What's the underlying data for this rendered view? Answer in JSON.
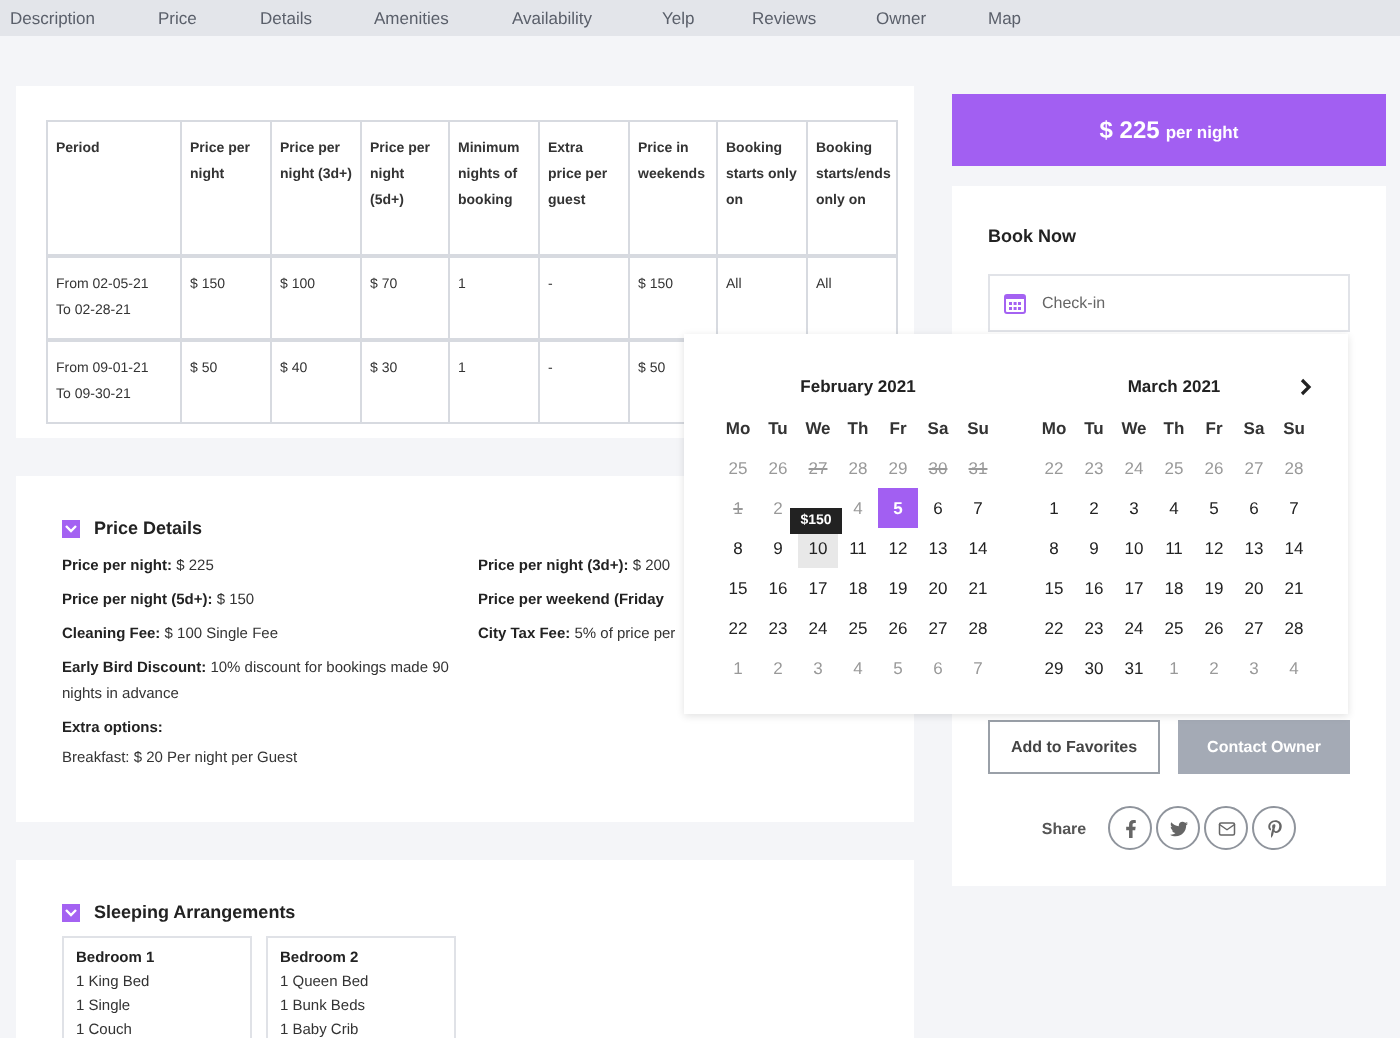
{
  "nav": [
    {
      "label": "Description"
    },
    {
      "label": "Price"
    },
    {
      "label": "Details"
    },
    {
      "label": "Amenities"
    },
    {
      "label": "Availability"
    },
    {
      "label": "Yelp"
    },
    {
      "label": "Reviews"
    },
    {
      "label": "Owner"
    },
    {
      "label": "Map"
    }
  ],
  "price_table": {
    "columns": [
      "Period",
      "Price per night",
      "Price per night (3d+)",
      "Price per night (5d+)",
      "Minimum nights of booking",
      "Extra price per guest",
      "Price in weekends",
      "Booking starts only on",
      "Booking starts/ends only on"
    ],
    "rows": [
      {
        "cells": [
          "From 02-05-21\nTo 02-28-21",
          "$ 150",
          "$ 100",
          "$ 70",
          "1",
          "-",
          "$ 150",
          "All",
          "All"
        ]
      },
      {
        "cells": [
          "From 09-01-21\nTo 09-30-21",
          "$ 50",
          "$ 40",
          "$ 30",
          "1",
          "-",
          "$ 50"
        ]
      }
    ]
  },
  "price_details": {
    "title": "Price Details",
    "expanded": true,
    "items": [
      {
        "label": "Price per night:",
        "value": "$ 225"
      },
      {
        "label": "Price per night (3d+):",
        "value": "$ 200"
      },
      {
        "label": "Price per night (5d+):",
        "value": "$ 150"
      },
      {
        "label": "Price per weekend (Friday"
      },
      {
        "label": "Cleaning Fee:",
        "value": "$ 100 Single Fee"
      },
      {
        "label": "City Tax Fee:",
        "value": "5% of price per"
      },
      {
        "label": "Early Bird Discount:",
        "value": "10% discount for bookings made 90 nights in advance"
      }
    ],
    "extra_title": "Extra options:",
    "extra_items": [
      "Breakfast: $ 20 Per night per Guest"
    ]
  },
  "sleeping": {
    "title": "Sleeping Arrangements",
    "expanded": true,
    "bedrooms": [
      {
        "name": "Bedroom 1",
        "beds": [
          "1 King Bed",
          "1 Single",
          "1 Couch"
        ]
      },
      {
        "name": "Bedroom 2",
        "beds": [
          "1 Queen Bed",
          "1 Bunk Beds",
          "1 Baby Crib"
        ]
      }
    ]
  },
  "price_bar": {
    "amount": "$ 225",
    "unit": "per night"
  },
  "booking": {
    "title": "Book Now",
    "checkin": {
      "placeholder": "Check-in"
    },
    "favorites": "Add to Favorites",
    "contact": "Contact Owner",
    "share_label": "Share"
  },
  "calendar": {
    "months": [
      {
        "title": "February 2021",
        "weekdays": [
          "Mo",
          "Tu",
          "We",
          "Th",
          "Fr",
          "Sa",
          "Su"
        ],
        "weeks": [
          [
            {
              "label": "25",
              "kind": "past",
              "selected": false
            },
            {
              "label": "26",
              "kind": "past",
              "selected": false
            },
            {
              "label": "27",
              "kind": "booked",
              "selected": false
            },
            {
              "label": "28",
              "kind": "past",
              "selected": false
            },
            {
              "label": "29",
              "kind": "past",
              "selected": false
            },
            {
              "label": "30",
              "kind": "booked",
              "selected": false
            },
            {
              "label": "31",
              "kind": "booked",
              "selected": false
            }
          ],
          [
            {
              "label": "1",
              "kind": "booked",
              "selected": false
            },
            {
              "label": "2",
              "kind": "past",
              "selected": false
            },
            {
              "kind": "past",
              "selected": false
            },
            {
              "label": "4",
              "kind": "past",
              "selected": false
            },
            {
              "label": "5",
              "kind": "day",
              "selected": true
            },
            {
              "label": "6",
              "kind": "day",
              "selected": false
            },
            {
              "label": "7",
              "kind": "day",
              "selected": false
            }
          ],
          [
            {
              "label": "8",
              "kind": "day",
              "selected": false
            },
            {
              "label": "9",
              "kind": "day",
              "selected": false
            },
            {
              "label": "10",
              "kind": "hover",
              "selected": false,
              "tooltip": "$150"
            },
            {
              "label": "11",
              "kind": "day",
              "selected": false
            },
            {
              "label": "12",
              "kind": "day",
              "selected": false
            },
            {
              "label": "13",
              "kind": "day",
              "selected": false
            },
            {
              "label": "14",
              "kind": "day",
              "selected": false
            }
          ],
          [
            {
              "label": "15",
              "kind": "day",
              "selected": false
            },
            {
              "label": "16",
              "kind": "day",
              "selected": false
            },
            {
              "label": "17",
              "kind": "day",
              "selected": false
            },
            {
              "label": "18",
              "kind": "day",
              "selected": false
            },
            {
              "label": "19",
              "kind": "day",
              "selected": false
            },
            {
              "label": "20",
              "kind": "day",
              "selected": false
            },
            {
              "label": "21",
              "kind": "day",
              "selected": false
            }
          ],
          [
            {
              "label": "22",
              "kind": "day",
              "selected": false
            },
            {
              "label": "23",
              "kind": "day",
              "selected": false
            },
            {
              "label": "24",
              "kind": "day",
              "selected": false
            },
            {
              "label": "25",
              "kind": "day",
              "selected": false
            },
            {
              "label": "26",
              "kind": "day",
              "selected": false
            },
            {
              "label": "27",
              "kind": "day",
              "selected": false
            },
            {
              "label": "28",
              "kind": "day",
              "selected": false
            }
          ],
          [
            {
              "label": "1",
              "kind": "other",
              "selected": false
            },
            {
              "label": "2",
              "kind": "other",
              "selected": false
            },
            {
              "label": "3",
              "kind": "other",
              "selected": false
            },
            {
              "label": "4",
              "kind": "other",
              "selected": false
            },
            {
              "label": "5",
              "kind": "other",
              "selected": false
            },
            {
              "label": "6",
              "kind": "other",
              "selected": false
            },
            {
              "label": "7",
              "kind": "other",
              "selected": false
            }
          ]
        ]
      },
      {
        "title": "March 2021",
        "weekdays": [
          "Mo",
          "Tu",
          "We",
          "Th",
          "Fr",
          "Sa",
          "Su"
        ],
        "weeks": [
          [
            {
              "label": "22",
              "kind": "other",
              "selected": false
            },
            {
              "label": "23",
              "kind": "other",
              "selected": false
            },
            {
              "label": "24",
              "kind": "other",
              "selected": false
            },
            {
              "label": "25",
              "kind": "other",
              "selected": false
            },
            {
              "label": "26",
              "kind": "other",
              "selected": false
            },
            {
              "label": "27",
              "kind": "other",
              "selected": false
            },
            {
              "label": "28",
              "kind": "other",
              "selected": false
            }
          ],
          [
            {
              "label": "1",
              "kind": "day",
              "selected": false
            },
            {
              "label": "2",
              "kind": "day",
              "selected": false
            },
            {
              "label": "3",
              "kind": "day",
              "selected": false
            },
            {
              "label": "4",
              "kind": "day",
              "selected": false
            },
            {
              "label": "5",
              "kind": "day",
              "selected": false
            },
            {
              "label": "6",
              "kind": "day",
              "selected": false
            },
            {
              "label": "7",
              "kind": "day",
              "selected": false
            }
          ],
          [
            {
              "label": "8",
              "kind": "day",
              "selected": false
            },
            {
              "label": "9",
              "kind": "day",
              "selected": false
            },
            {
              "label": "10",
              "kind": "day",
              "selected": false
            },
            {
              "label": "11",
              "kind": "day",
              "selected": false
            },
            {
              "label": "12",
              "kind": "day",
              "selected": false
            },
            {
              "label": "13",
              "kind": "day",
              "selected": false
            },
            {
              "label": "14",
              "kind": "day",
              "selected": false
            }
          ],
          [
            {
              "label": "15",
              "kind": "day",
              "selected": false
            },
            {
              "label": "16",
              "kind": "day",
              "selected": false
            },
            {
              "label": "17",
              "kind": "day",
              "selected": false
            },
            {
              "label": "18",
              "kind": "day",
              "selected": false
            },
            {
              "label": "19",
              "kind": "day",
              "selected": false
            },
            {
              "label": "20",
              "kind": "day",
              "selected": false
            },
            {
              "label": "21",
              "kind": "day",
              "selected": false
            }
          ],
          [
            {
              "label": "22",
              "kind": "day",
              "selected": false
            },
            {
              "label": "23",
              "kind": "day",
              "selected": false
            },
            {
              "label": "24",
              "kind": "day",
              "selected": false
            },
            {
              "label": "25",
              "kind": "day",
              "selected": false
            },
            {
              "label": "26",
              "kind": "day",
              "selected": false
            },
            {
              "label": "27",
              "kind": "day",
              "selected": false
            },
            {
              "label": "28",
              "kind": "day",
              "selected": false
            }
          ],
          [
            {
              "label": "29",
              "kind": "day",
              "selected": false
            },
            {
              "label": "30",
              "kind": "day",
              "selected": false
            },
            {
              "label": "31",
              "kind": "day",
              "selected": false
            },
            {
              "label": "1",
              "kind": "other",
              "selected": false
            },
            {
              "label": "2",
              "kind": "other",
              "selected": false
            },
            {
              "label": "3",
              "kind": "other",
              "selected": false
            },
            {
              "label": "4",
              "kind": "other",
              "selected": false
            }
          ]
        ]
      }
    ]
  }
}
